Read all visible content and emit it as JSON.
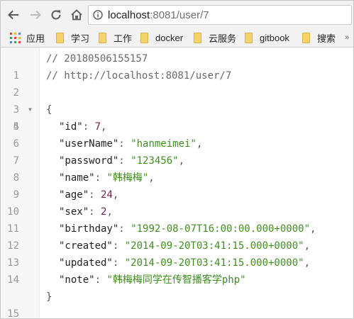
{
  "browser": {
    "url_host": "localhost",
    "url_rest": ":8081/user/7"
  },
  "bookmarks": [
    {
      "label": "应用"
    },
    {
      "label": "学习"
    },
    {
      "label": "工作"
    },
    {
      "label": "docker"
    },
    {
      "label": "云服务"
    },
    {
      "label": "gitbook"
    },
    {
      "label": "搜索"
    }
  ],
  "viewer": {
    "line_numbers": [
      "1",
      "2",
      "3",
      "4",
      "5",
      "6",
      "7",
      "8",
      "9",
      "10",
      "11",
      "12",
      "13",
      "14",
      "15"
    ],
    "comment_timestamp": "// 20180506155157",
    "comment_url": "// http://localhost:8081/user/7",
    "open_brace": "{",
    "close_brace": "}",
    "fields": [
      {
        "key": "\"id\"",
        "value": "7",
        "type": "num",
        "comma": ","
      },
      {
        "key": "\"userName\"",
        "value": "\"hanmeimei\"",
        "type": "str",
        "comma": ","
      },
      {
        "key": "\"password\"",
        "value": "\"123456\"",
        "type": "str",
        "comma": ","
      },
      {
        "key": "\"name\"",
        "value": "\"韩梅梅\"",
        "type": "str",
        "comma": ","
      },
      {
        "key": "\"age\"",
        "value": "24",
        "type": "num",
        "comma": ","
      },
      {
        "key": "\"sex\"",
        "value": "2",
        "type": "num",
        "comma": ","
      },
      {
        "key": "\"birthday\"",
        "value": "\"1992-08-07T16:00:00.000+0000\"",
        "type": "str",
        "comma": ","
      },
      {
        "key": "\"created\"",
        "value": "\"2014-09-20T03:41:15.000+0000\"",
        "type": "str",
        "comma": ","
      },
      {
        "key": "\"updated\"",
        "value": "\"2014-09-20T03:41:15.000+0000\"",
        "type": "str",
        "comma": ","
      },
      {
        "key": "\"note\"",
        "value": "\"韩梅梅同学在传智播客学php\"",
        "type": "str",
        "comma": ""
      }
    ],
    "colon": ": "
  },
  "colors": {
    "string": "#3f8f1f",
    "number": "#7a1f4a",
    "comment": "#6a6a6a"
  }
}
